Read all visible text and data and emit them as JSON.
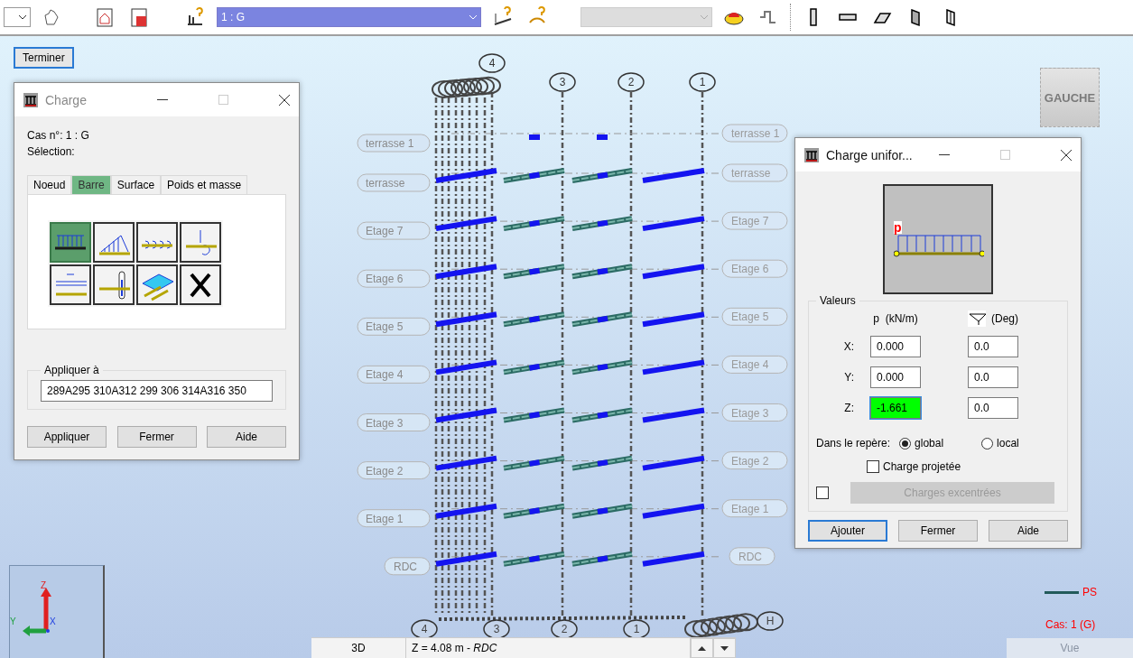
{
  "toolbar": {
    "case_select": "1 : G"
  },
  "finish_button": "Terminer",
  "view_cube": "GAUCHE",
  "structure": {
    "top_axes": [
      "4",
      "3",
      "2",
      "1"
    ],
    "levels": [
      {
        "left": "terrasse 1",
        "right": "terrasse 1",
        "kind": "partial"
      },
      {
        "left": "terrasse",
        "right": "terrasse",
        "kind": "floor"
      },
      {
        "left": "Etage 7",
        "right": "Etage 7",
        "kind": "floor"
      },
      {
        "left": "Etage 6",
        "right": "Etage 6",
        "kind": "floor"
      },
      {
        "left": "Etage 5",
        "right": "Etage 5",
        "kind": "floor"
      },
      {
        "left": "Etage 4",
        "right": "Etage 4",
        "kind": "floor"
      },
      {
        "left": "Etage 3",
        "right": "Etage 3",
        "kind": "floor"
      },
      {
        "left": "Etage 2",
        "right": "Etage 2",
        "kind": "floor"
      },
      {
        "left": "Etage 1",
        "right": "Etage 1",
        "kind": "floor"
      },
      {
        "left": "RDC",
        "right": "RDC",
        "kind": "floor"
      }
    ],
    "bottom_axes": [
      "4",
      "3",
      "2",
      "1",
      "H"
    ]
  },
  "charge_dialog": {
    "title": "Charge",
    "case_line": "Cas n°: 1 : G",
    "selection_label": "Sélection:",
    "tabs": [
      {
        "label": "Noeud",
        "selected": false
      },
      {
        "label": "Barre",
        "selected": true
      },
      {
        "label": "Surface",
        "selected": false
      },
      {
        "label": "Poids et masse",
        "selected": false
      }
    ],
    "tools": [
      {
        "kind": "uniform",
        "selected": true
      },
      {
        "kind": "trapezoid",
        "selected": false
      },
      {
        "kind": "moment",
        "selected": false
      },
      {
        "kind": "point",
        "selected": false
      },
      {
        "kind": "dilatation",
        "selected": false
      },
      {
        "kind": "thermal",
        "selected": false
      },
      {
        "kind": "surface",
        "selected": false
      },
      {
        "kind": "delete",
        "selected": false
      }
    ],
    "apply_group": {
      "label": "Appliquer à",
      "value": "289A295 310A312 299 306 314A316 350"
    },
    "buttons": [
      "Appliquer",
      "Fermer",
      "Aide"
    ]
  },
  "uniform_dialog": {
    "title": "Charge unifor...",
    "diagram_label": "p",
    "group_label": "Valeurs",
    "value_header": "p  (kN/m)",
    "angle_header": "(Deg)",
    "rows": [
      {
        "axis": "X:",
        "value": "0.000",
        "angle": "0.0",
        "highlighted": false
      },
      {
        "axis": "Y:",
        "value": "0.000",
        "angle": "0.0",
        "highlighted": false
      },
      {
        "axis": "Z:",
        "value": "-1.661",
        "angle": "0.0",
        "highlighted": true
      }
    ],
    "frame": {
      "label": "Dans le repère:",
      "options": [
        {
          "label": "global",
          "selected": true
        },
        {
          "label": "local",
          "selected": false
        }
      ]
    },
    "projected": {
      "label": "Charge projetée",
      "checked": false
    },
    "eccentric": {
      "checked": false,
      "button": "Charges excentrées",
      "disabled": true
    },
    "buttons": [
      {
        "label": "Ajouter",
        "default": true
      },
      {
        "label": "Fermer",
        "default": false
      },
      {
        "label": "Aide",
        "default": false
      }
    ]
  },
  "axis_gizmo": {
    "z": "Z",
    "y": "Y",
    "x": "X"
  },
  "legend": {
    "series": "PS",
    "case": "Cas: 1 (G)"
  },
  "status_bar": {
    "view": "3D",
    "position": "Z = 4.08 m - *RDC*",
    "view_button": "Vue"
  }
}
